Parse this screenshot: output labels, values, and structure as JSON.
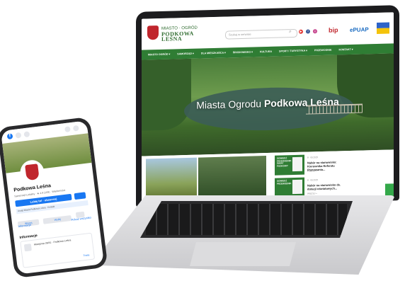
{
  "website": {
    "logo_small": "MIASTO · OGRÓD",
    "logo_name_1": "PODKOWA",
    "logo_name_2": "LEŚNA",
    "search_placeholder": "Szukaj w serwisie",
    "bip_label": "bip",
    "epuap_label": "ePUAP",
    "nav": [
      "MIASTO OGRÓD ▾",
      "SAMORZĄD ▾",
      "DLA MIESZKAŃCA ▾",
      "ŚRODOWISKO ▾",
      "KULTURA",
      "SPORT I TURYSTYKA ▾",
      "PRZEWODNIK",
      "KONTAKT ▾"
    ],
    "hero_title_regular": "Miasta Ogrodu",
    "hero_title_bold": "Podkowa Leśna",
    "news_cards": [
      {
        "img_label": "ODWIEDŹ PRZEWODNIK ŚWIAT PODKOWY",
        "meta": "8 · 09.2025",
        "title": "Nabór na stanowisko: Kierownika Referatu Planowania...",
        "more": "WIĘCEJ »"
      },
      {
        "img_label": "ODWIEDŹ PRZEWODNIK",
        "meta": "8 · 09.2025",
        "title": "Nabór na stanowisko ds. dotacji oświatowych...",
        "more": "WIĘCEJ »"
      }
    ]
  },
  "phone": {
    "page_name": "Podkowa Leśna",
    "subtitle": "Samorząd Lokalny · ★ 4.9 (109) · Wiadomości",
    "like_label": "Lubię to! · obserwuj",
    "info_line": "Urząd Miasta Podkowa Leśna · Kontakt",
    "btn_more": "Więcej",
    "btn_message": "Wyślij",
    "tab_left": "Informacje",
    "tab_right": "Pokaż wszystko",
    "section": "Informacje",
    "address": "Akacjowa 39/41 · Podkowa Leśna",
    "directions": "Trasa"
  },
  "colors": {
    "brand_green": "#2f7d34",
    "brand_red": "#c0262d",
    "facebook_blue": "#1877f2"
  }
}
